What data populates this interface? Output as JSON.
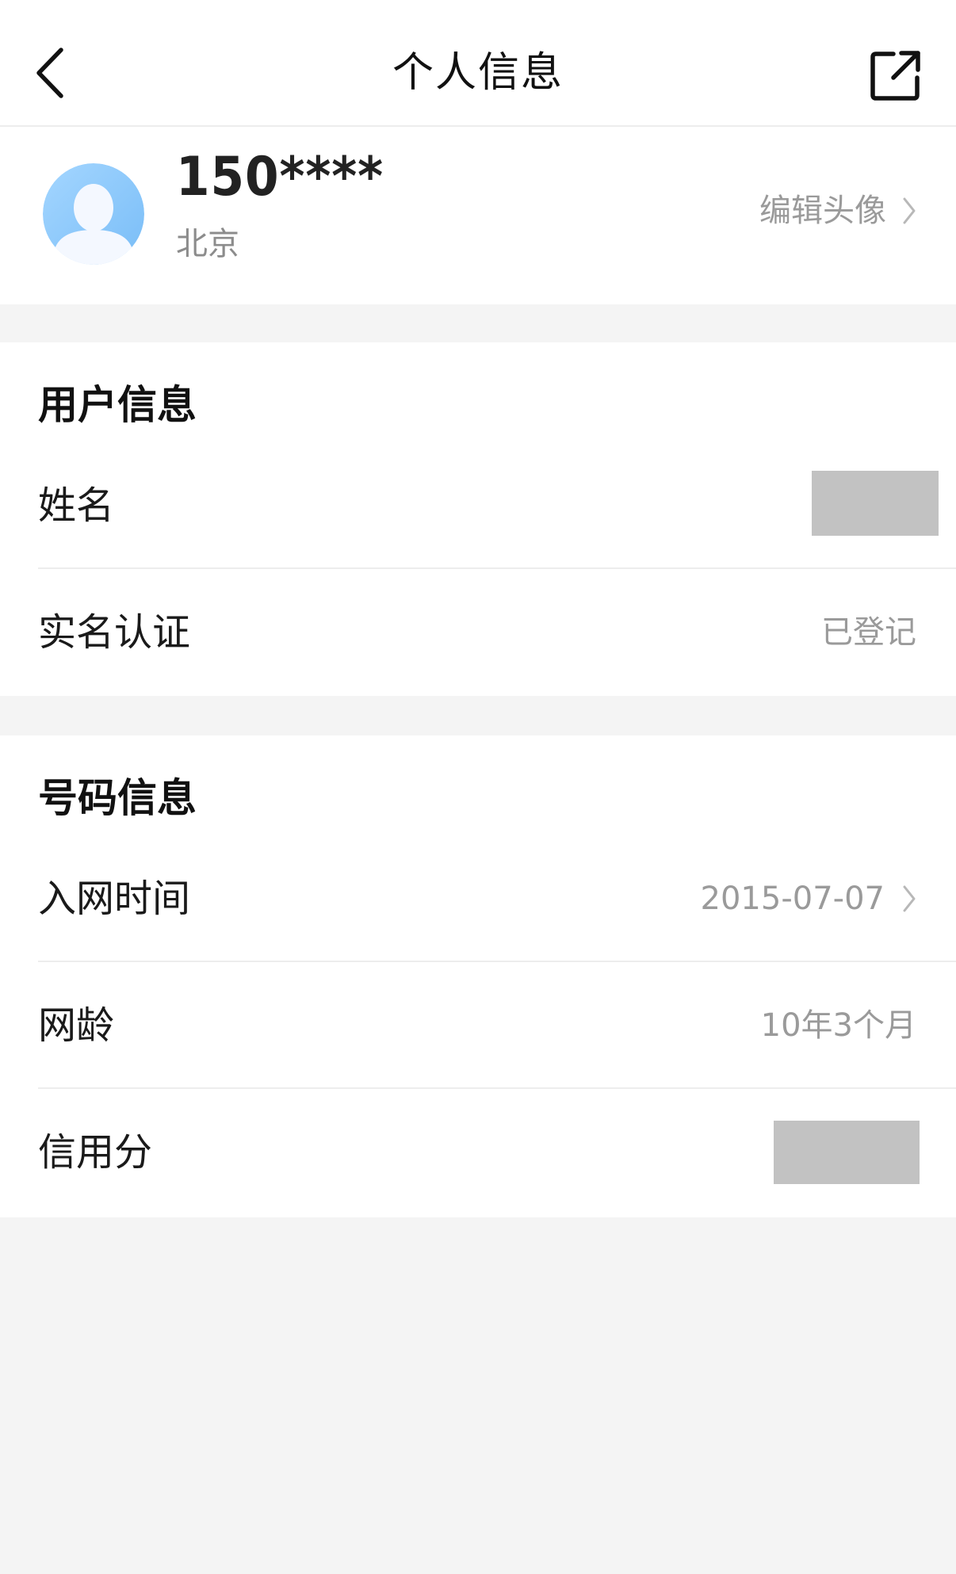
{
  "navbar": {
    "title": "个人信息",
    "back_icon": "chevron-left-icon",
    "share_icon": "external-link-icon"
  },
  "profile": {
    "phone": "150****",
    "city": "北京",
    "edit_avatar_label": "编辑头像",
    "avatar_icon": "default-avatar-icon",
    "avatar_color": "#8ec9fb"
  },
  "user_info": {
    "title": "用户信息",
    "rows": [
      {
        "label": "姓名",
        "value": "",
        "redacted": true
      },
      {
        "label": "实名认证",
        "value": "已登记"
      }
    ]
  },
  "number_info": {
    "title": "号码信息",
    "rows": [
      {
        "label": "入网时间",
        "value": "2015-07-07",
        "chevron": true
      },
      {
        "label": "网龄",
        "value": "10年3个月"
      },
      {
        "label": "信用分",
        "value": "",
        "redacted": true
      }
    ]
  },
  "colors": {
    "background": "#f4f4f4",
    "card": "#ffffff",
    "secondary_text": "#9a9a9a",
    "redaction": "#c2c2c2",
    "divider": "#ededed"
  }
}
